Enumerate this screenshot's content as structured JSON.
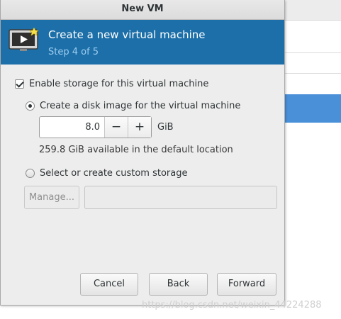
{
  "window": {
    "title": "New VM"
  },
  "banner": {
    "title": "Create a new virtual machine",
    "step": "Step 4 of 5",
    "icon": "vm-screen-icon"
  },
  "storage": {
    "enable_label": "Enable storage for this virtual machine",
    "enable_checked": true,
    "disk_image_label": "Create a disk image for the virtual machine",
    "size_value": "8.0",
    "decrement": "−",
    "increment": "+",
    "unit": "GiB",
    "available": "259.8 GiB available in the default location",
    "custom_label": "Select or create custom storage",
    "manage_label": "Manage...",
    "custom_path": ""
  },
  "footer": {
    "cancel": "Cancel",
    "back": "Back",
    "forward": "Forward"
  },
  "watermark": "https://blog.csdn.net/weixin_44224288",
  "colors": {
    "banner": "#1c6fa8",
    "selection": "#4a90d9",
    "step_text": "#9fcdf0"
  }
}
